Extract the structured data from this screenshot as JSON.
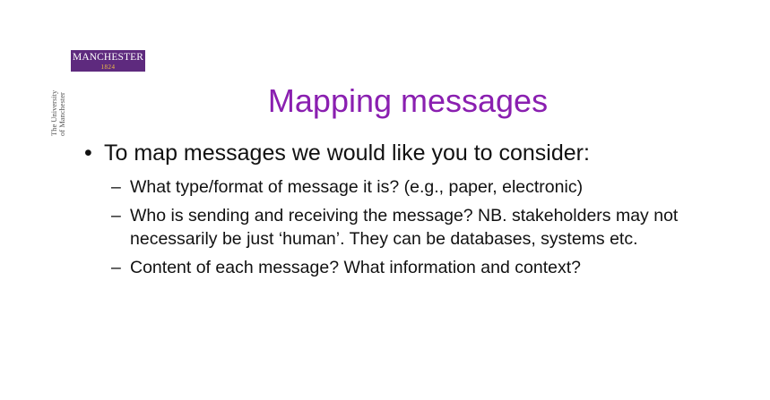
{
  "logo": {
    "name": "MANCHESTER",
    "year": "1824"
  },
  "university": {
    "line1": "The University",
    "line2": "of Manchester"
  },
  "slide": {
    "title": "Mapping messages",
    "main_bullet": "To map messages we would like you to consider:",
    "sub_bullets": [
      "What type/format of message it is?  (e.g., paper, electronic)",
      "Who is sending and receiving the message? NB. stakeholders may not necessarily be just ‘human’. They can be databases, systems etc.",
      "Content of each message? What information and context?"
    ]
  },
  "colors": {
    "title": "#8a1fb0",
    "logo_bg": "#5e2a7e",
    "logo_year": "#f3c243"
  }
}
